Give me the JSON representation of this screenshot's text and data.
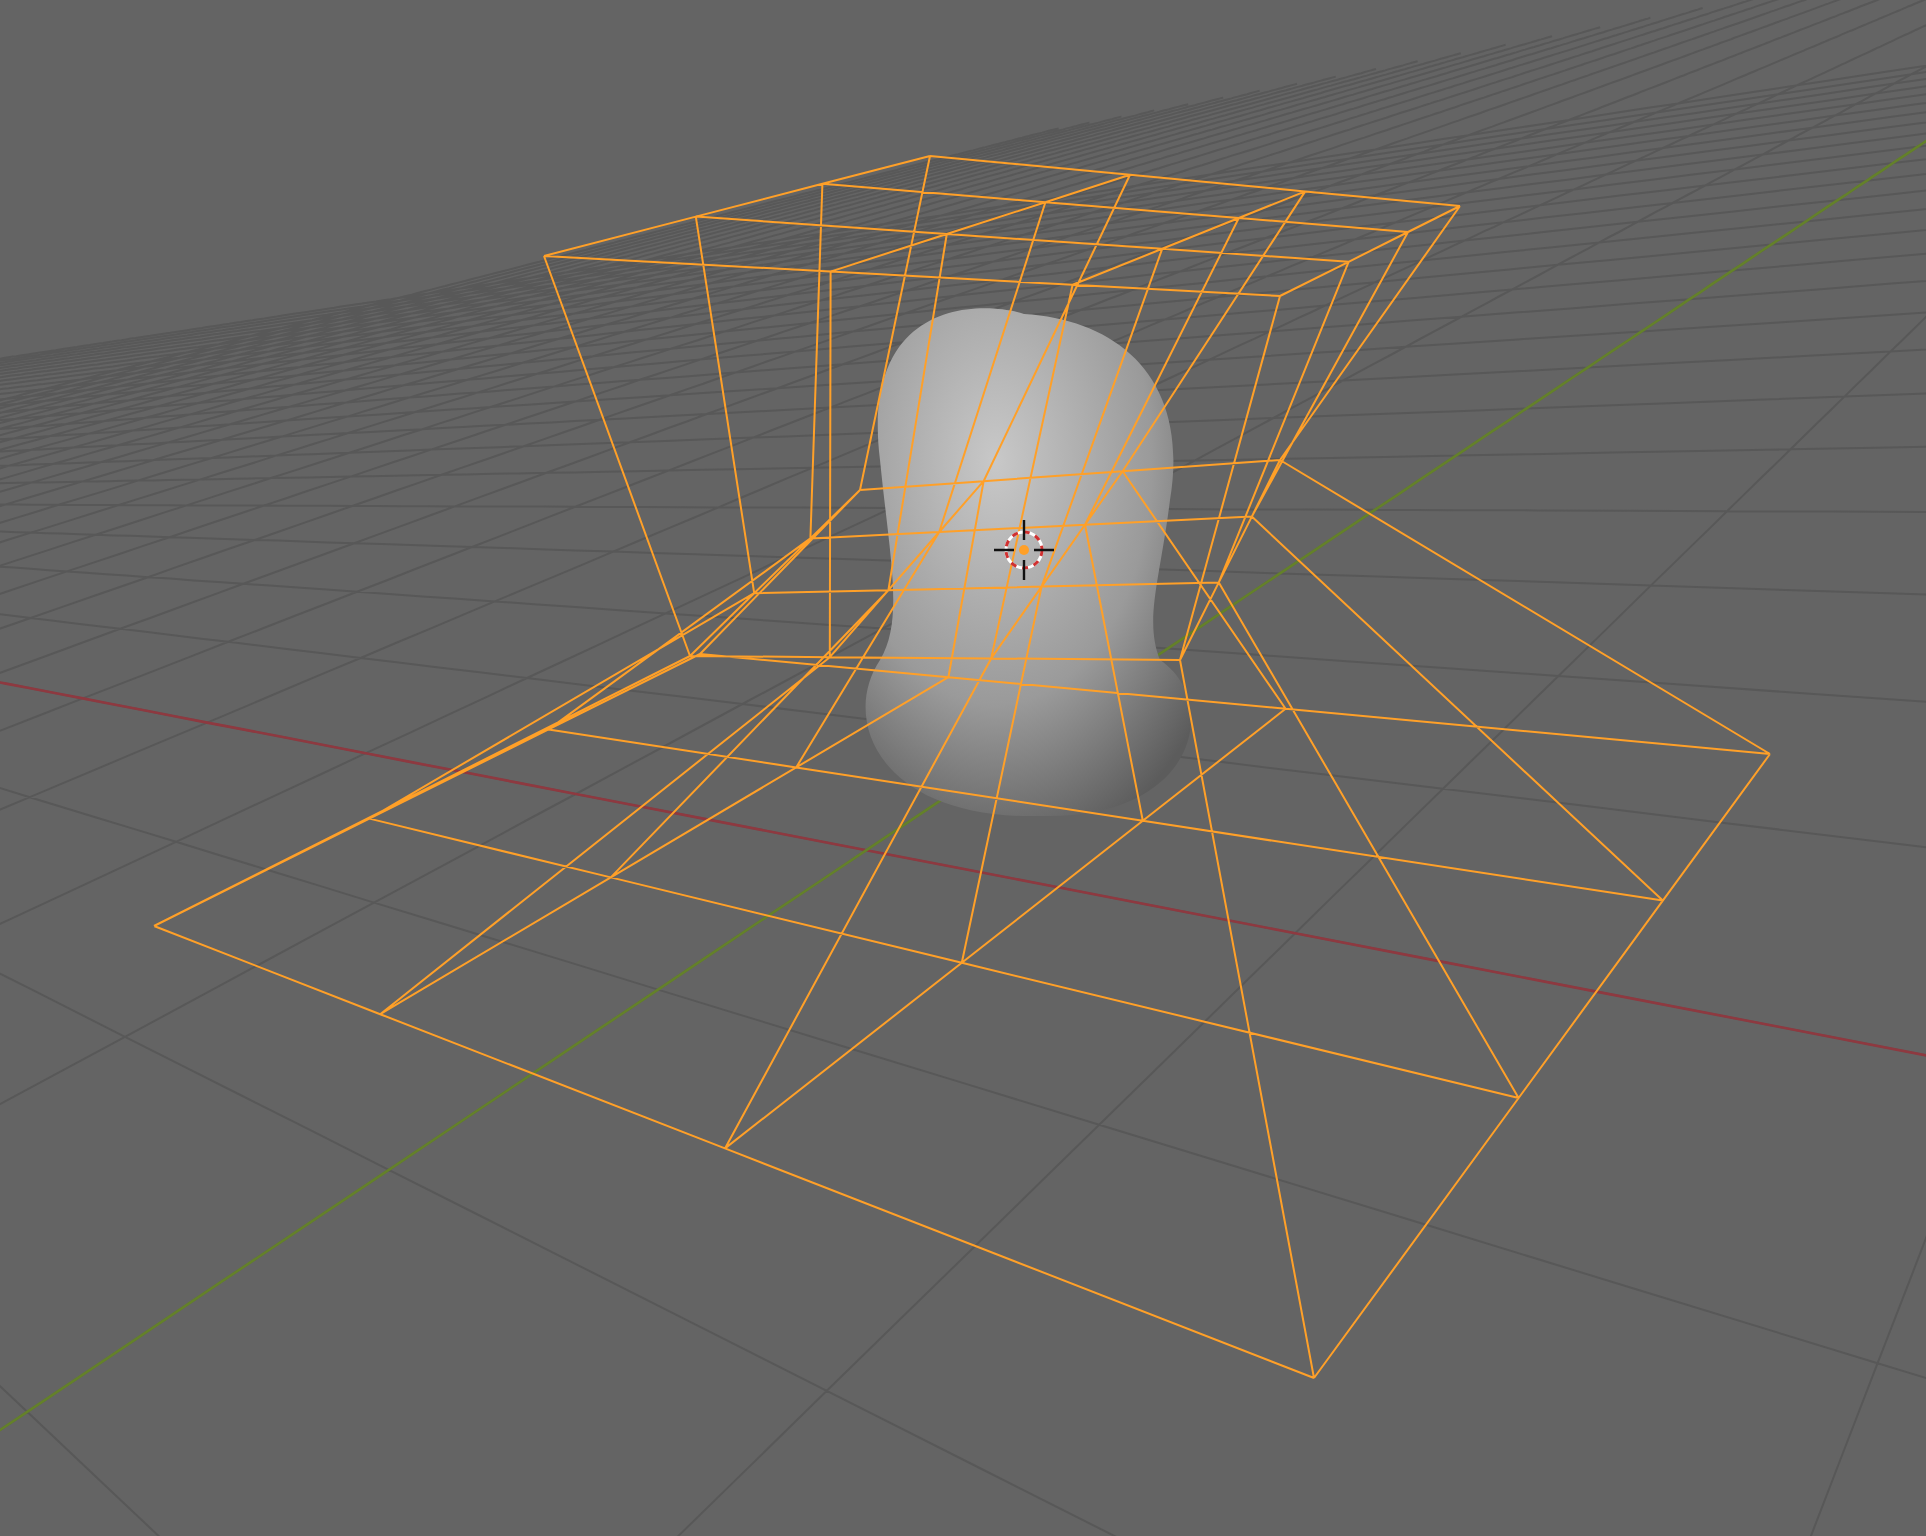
{
  "viewport": {
    "axes": [
      {
        "kind": "x",
        "color": "#8e3940"
      },
      {
        "kind": "y",
        "color": "#64812a"
      }
    ],
    "objects": [
      {
        "kind": "mesh",
        "selected": false
      },
      {
        "kind": "lattice",
        "selected": true
      }
    ],
    "cursor": true
  }
}
